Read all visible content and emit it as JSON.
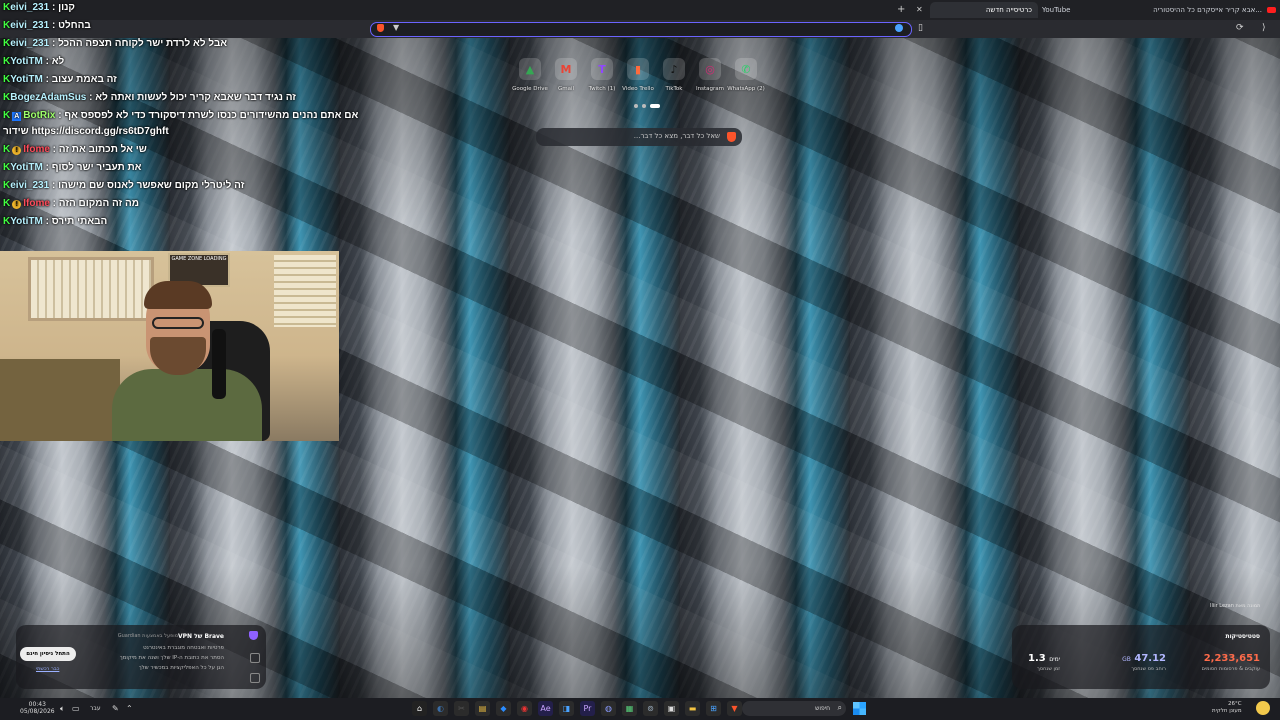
{
  "browser": {
    "tabs": [
      {
        "id": "yt-stream",
        "label": "אבא קריר אייסקרם כל ההיסטוריה..."
      },
      {
        "id": "youtube",
        "label": "YouTube"
      },
      {
        "id": "new-tab",
        "label": "כרטיסייה חדשה"
      }
    ],
    "address_value": ""
  },
  "chat": [
    {
      "user": "eivi_231",
      "sep": " : ",
      "msg": "קנון",
      "color": "blue"
    },
    {
      "user": "eivi_231",
      "sep": " : ",
      "msg": "בהחלט",
      "color": "blue"
    },
    {
      "user": "eivi_231",
      "sep": " : ",
      "msg": "אבל לא לרדת ישר לקוחה תצפה ההכל",
      "color": "blue"
    },
    {
      "user": "YotiTM",
      "sep": " : ",
      "msg": "לא",
      "color": "blue"
    },
    {
      "user": "YotiTM",
      "sep": " : ",
      "msg": "זה באמת עצוב",
      "color": "blue"
    },
    {
      "user": "BogezAdamSus",
      "sep": " : ",
      "msg": "זה נגיד דבר שאבא קריר יכול לעשות ואתה לא",
      "color": "blue"
    },
    {
      "user": "BotRix",
      "sep": " : ",
      "msg": "אם אתם נהנים מהשידורים כנסו לשרת דיסקורד כדי לא לפספס אף",
      "color": "green"
    },
    {
      "user": "",
      "sep": "",
      "msg": "https://discord.gg/rs6tD7ghft שידור",
      "color": "blue"
    },
    {
      "user": "Ifome",
      "sep": " : ",
      "msg": "שי אל תכתוב את זה",
      "color": "red"
    },
    {
      "user": "YotiTM",
      "sep": " : ",
      "msg": "את תעביר ישר לסוף",
      "color": "blue"
    },
    {
      "user": "eivi_231",
      "sep": " : ",
      "msg": "זה ליטרלי מקום שאפשר לאנוס שם מישהו",
      "color": "blue"
    },
    {
      "user": "Ifome",
      "sep": " : ",
      "msg": "מה זה המקום הזה",
      "color": "red"
    },
    {
      "user": "YotiTM",
      "sep": " : ",
      "msg": "הבאתי תירס",
      "color": "blue"
    }
  ],
  "webcam": {
    "sign_text": "GAME ZONE LOADING"
  },
  "shortcuts": [
    {
      "label": "Google Drive",
      "glyph": "▲",
      "color": "#34a853"
    },
    {
      "label": "Gmail",
      "glyph": "M",
      "color": "#ea4335"
    },
    {
      "label": "Twitch (1)",
      "glyph": "T",
      "color": "#9146ff"
    },
    {
      "label": "Video Trello",
      "glyph": "▮",
      "color": "#ff6b3d"
    },
    {
      "label": "TikTok",
      "glyph": "♪",
      "color": "#111111"
    },
    {
      "label": "Instagram",
      "glyph": "◎",
      "color": "#d62976"
    },
    {
      "label": "WhatsApp (2)",
      "glyph": "✆",
      "color": "#25d366"
    }
  ],
  "search": {
    "placeholder": "שאל כל דבר, מצא כל דבר..."
  },
  "vpn": {
    "title": "Brave של VPN",
    "subtitle": "מופעל באמצעות Guardian",
    "items": [
      "פרטיות ואבטחה מוגברת באינטרנט",
      "הסתר את כתובת ה-IP שלך ושנה את מיקומך",
      "הגן על כל האפליקציות במכשיר שלך"
    ],
    "start_label": "התחל ניסיון חינם",
    "link_label": "כבר רכשתי"
  },
  "stats": {
    "title": "סטטיסטיקות",
    "ads_value": "2,233,651",
    "ads_label": "עוקבים & פרסומות חסומים",
    "data_value": "47.12",
    "data_unit": "GB",
    "data_label": "רוחב פס שנחסך",
    "time_value": "1.3",
    "time_unit": "ימים",
    "time_label": "זמן שנחסך"
  },
  "photo_credit": "תמונה מאת Iliir Lezan",
  "taskbar": {
    "time": "00:43",
    "date": "05/08/2026",
    "lang": "עבר",
    "search_label": "חיפוש",
    "weather_temp": "26°C",
    "weather_desc": "מעונן חלקית"
  },
  "colors": {
    "accent": "#6b64ff",
    "brave": "#fb542b",
    "ads": "#ff6b4a",
    "data": "#b2b7ff"
  }
}
